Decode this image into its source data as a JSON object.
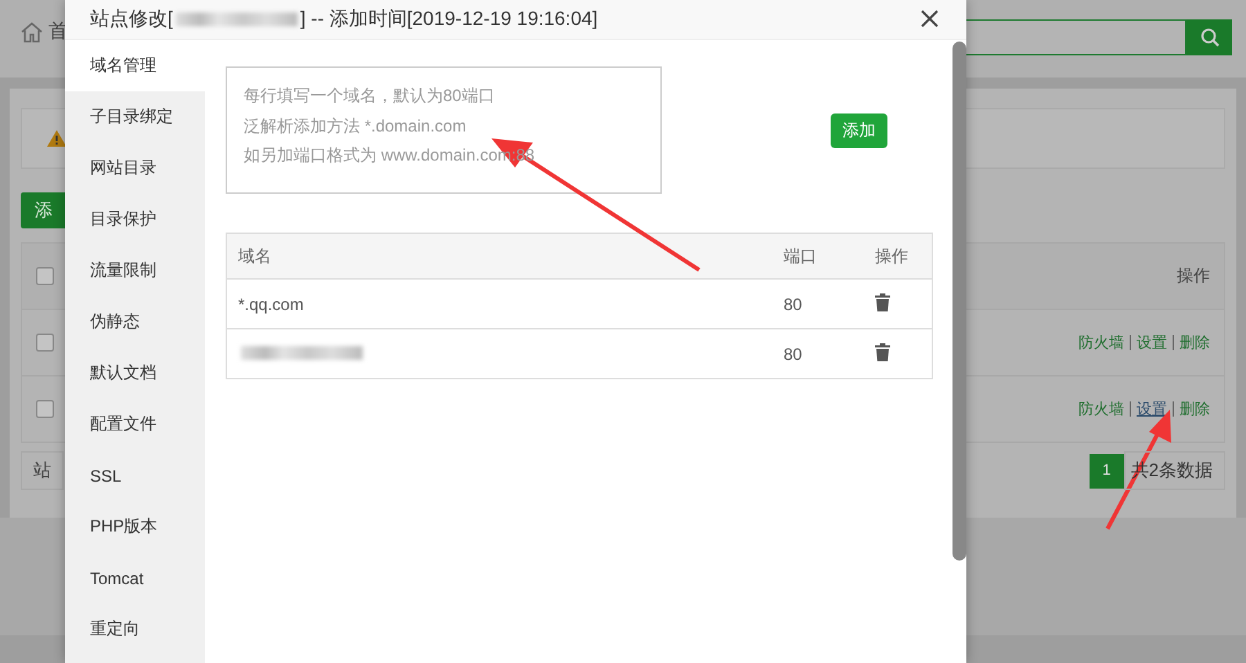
{
  "background": {
    "breadcrumb": "首",
    "add_button": "添",
    "table": {
      "header": {
        "checked": false,
        "action_label": "操作"
      },
      "rows": [
        {
          "checked": false,
          "actions": [
            {
              "label": "防火墙",
              "underlined": false
            },
            {
              "label": "设置",
              "underlined": false
            },
            {
              "label": "删除",
              "underlined": false
            }
          ]
        },
        {
          "checked": false,
          "actions": [
            {
              "label": "防火墙",
              "underlined": false
            },
            {
              "label": "设置",
              "underlined": true
            },
            {
              "label": "删除",
              "underlined": false
            }
          ]
        }
      ]
    },
    "footer_label": "站",
    "pagination": {
      "pages": [
        {
          "label": "1",
          "selected": true
        }
      ],
      "summary": "共2条数据"
    }
  },
  "dialog": {
    "title_prefix": "站点修改[",
    "title_suffix": "] -- 添加时间[2019-12-19 19:16:04]",
    "tabs": [
      {
        "label": "域名管理",
        "selected": true
      },
      {
        "label": "子目录绑定",
        "selected": false
      },
      {
        "label": "网站目录",
        "selected": false
      },
      {
        "label": "目录保护",
        "selected": false
      },
      {
        "label": "流量限制",
        "selected": false
      },
      {
        "label": "伪静态",
        "selected": false
      },
      {
        "label": "默认文档",
        "selected": false
      },
      {
        "label": "配置文件",
        "selected": false
      },
      {
        "label": "SSL",
        "selected": false
      },
      {
        "label": "PHP版本",
        "selected": false
      },
      {
        "label": "Tomcat",
        "selected": false
      },
      {
        "label": "重定向",
        "selected": false
      }
    ],
    "domain_input": {
      "placeholder": [
        "每行填写一个域名，默认为80端口",
        "泛解析添加方法 *.domain.com",
        "如另加端口格式为 www.domain.com:88"
      ]
    },
    "add_button": "添加",
    "table": {
      "columns": [
        "域名",
        "端口",
        "操作"
      ],
      "rows": [
        {
          "kind": "text",
          "domain": "*.qq.com",
          "port": "80"
        },
        {
          "kind": "redacted",
          "port": "80"
        }
      ]
    }
  }
}
